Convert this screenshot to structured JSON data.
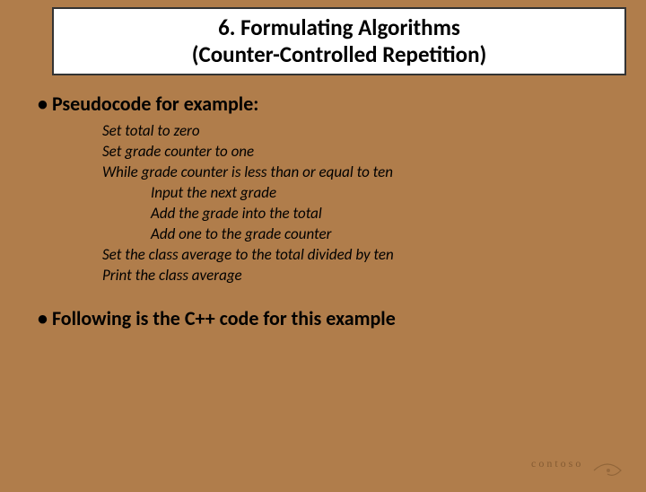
{
  "title": {
    "line1": "6.   Formulating Algorithms",
    "line2": "(Counter-Controlled Repetition)"
  },
  "bullet1": "Pseudocode for example:",
  "pseudo": {
    "l1": "Set total to zero",
    "l2": "Set grade counter to one",
    "l3": "While grade counter is less than or equal to ten",
    "l4": "Input the next grade",
    "l5": "Add the grade into the total",
    "l6": "Add one to the grade counter",
    "l7": "Set the class average to the total divided by ten",
    "l8": " Print the class average"
  },
  "bullet2": "Following is the C++ code for this example",
  "logo_text": "contoso"
}
